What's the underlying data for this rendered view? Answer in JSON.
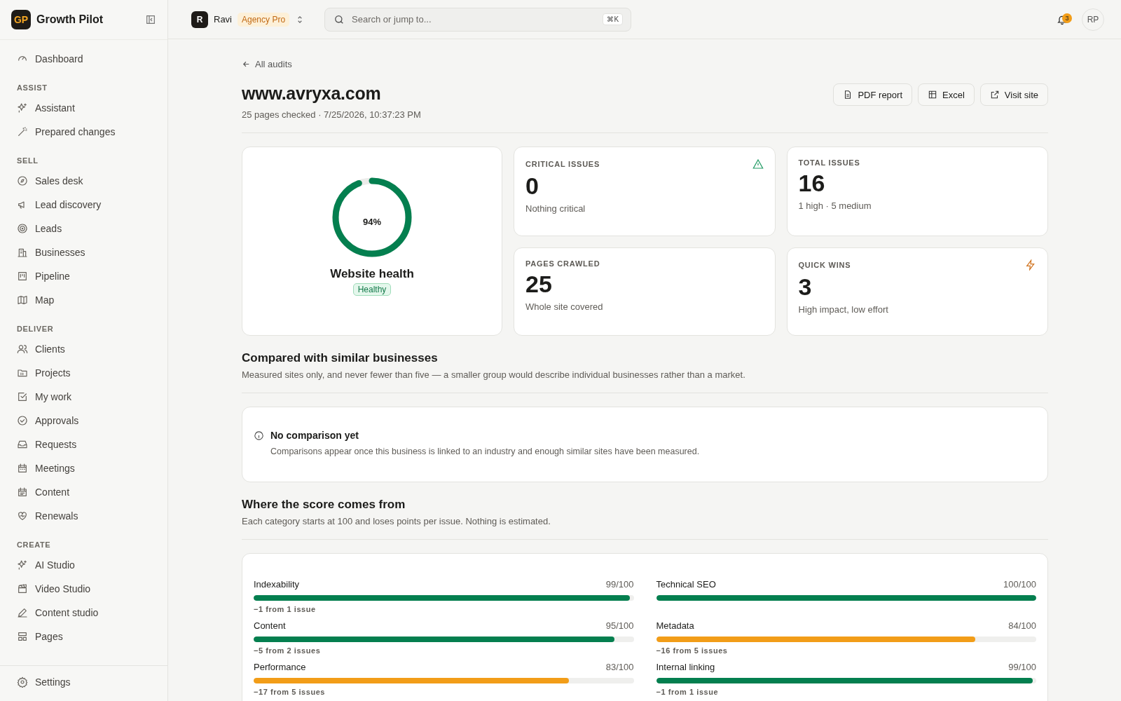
{
  "brand": {
    "logo": "GP",
    "name": "Growth Pilot"
  },
  "sidebar": {
    "top": [
      {
        "label": "Dashboard"
      }
    ],
    "sections": [
      {
        "title": "ASSIST",
        "items": [
          {
            "label": "Assistant"
          },
          {
            "label": "Prepared changes"
          }
        ]
      },
      {
        "title": "SELL",
        "items": [
          {
            "label": "Sales desk"
          },
          {
            "label": "Lead discovery"
          },
          {
            "label": "Leads"
          },
          {
            "label": "Businesses"
          },
          {
            "label": "Pipeline"
          },
          {
            "label": "Map"
          }
        ]
      },
      {
        "title": "DELIVER",
        "items": [
          {
            "label": "Clients"
          },
          {
            "label": "Projects"
          },
          {
            "label": "My work"
          },
          {
            "label": "Approvals"
          },
          {
            "label": "Requests"
          },
          {
            "label": "Meetings"
          },
          {
            "label": "Content"
          },
          {
            "label": "Renewals"
          }
        ]
      },
      {
        "title": "CREATE",
        "items": [
          {
            "label": "AI Studio"
          },
          {
            "label": "Video Studio"
          },
          {
            "label": "Content studio"
          },
          {
            "label": "Pages"
          }
        ]
      }
    ],
    "bottom": [
      {
        "label": "Settings"
      }
    ]
  },
  "topbar": {
    "workspace": {
      "initial": "R",
      "name": "Ravi",
      "plan": "Agency Pro"
    },
    "search": {
      "placeholder": "Search or jump to...",
      "shortcut": "⌘K"
    },
    "notifications": "3",
    "avatar": "RP"
  },
  "back_link": "All audits",
  "title": "www.avryxa.com",
  "subtitle": "25 pages checked · 7/25/2026, 10:37:23 PM",
  "actions": [
    {
      "label": "PDF report"
    },
    {
      "label": "Excel"
    },
    {
      "label": "Visit site"
    }
  ],
  "health": {
    "percent": "94%",
    "level": 0.94,
    "label": "Website health",
    "status": "Healthy"
  },
  "stats": [
    {
      "title": "CRITICAL ISSUES",
      "value": "0",
      "note": "Nothing critical",
      "kind": "warning"
    },
    {
      "title": "TOTAL ISSUES",
      "value": "16",
      "note": "1 high · 5 medium",
      "kind": "plain"
    },
    {
      "title": "PAGES CRAWLED",
      "value": "25",
      "note": "Whole site covered",
      "kind": "plain"
    },
    {
      "title": "QUICK WINS",
      "value": "3",
      "note": "High impact, low effort",
      "kind": "bolt"
    }
  ],
  "comparison": {
    "title": "Compared with similar businesses",
    "description": "Measured sites only, and never fewer than five — a smaller group would describe individual businesses rather than a market.",
    "empty_title": "No comparison yet",
    "empty_text": "Comparisons appear once this business is linked to an industry and enough similar sites have been measured."
  },
  "score": {
    "title": "Where the score comes from",
    "description": "Each category starts at 100 and loses points per issue. Nothing is estimated.",
    "categories": [
      {
        "name": "Indexability",
        "score": "99/100",
        "level": 0.99,
        "color": "#047f4f",
        "deduction": "−1 from 1 issue"
      },
      {
        "name": "Technical SEO",
        "score": "100/100",
        "level": 1,
        "color": "#047f4f"
      },
      {
        "name": "Content",
        "score": "95/100",
        "level": 0.95,
        "color": "#047f4f",
        "deduction": "−5 from 2 issues"
      },
      {
        "name": "Metadata",
        "score": "84/100",
        "level": 0.84,
        "color": "#f29d18",
        "deduction": "−16 from 5 issues"
      },
      {
        "name": "Performance",
        "score": "83/100",
        "level": 0.83,
        "color": "#f29d18",
        "deduction": "−17 from 5 issues"
      },
      {
        "name": "Internal linking",
        "score": "99/100",
        "level": 0.99,
        "color": "#047f4f",
        "deduction": "−1 from 1 issue"
      }
    ]
  }
}
